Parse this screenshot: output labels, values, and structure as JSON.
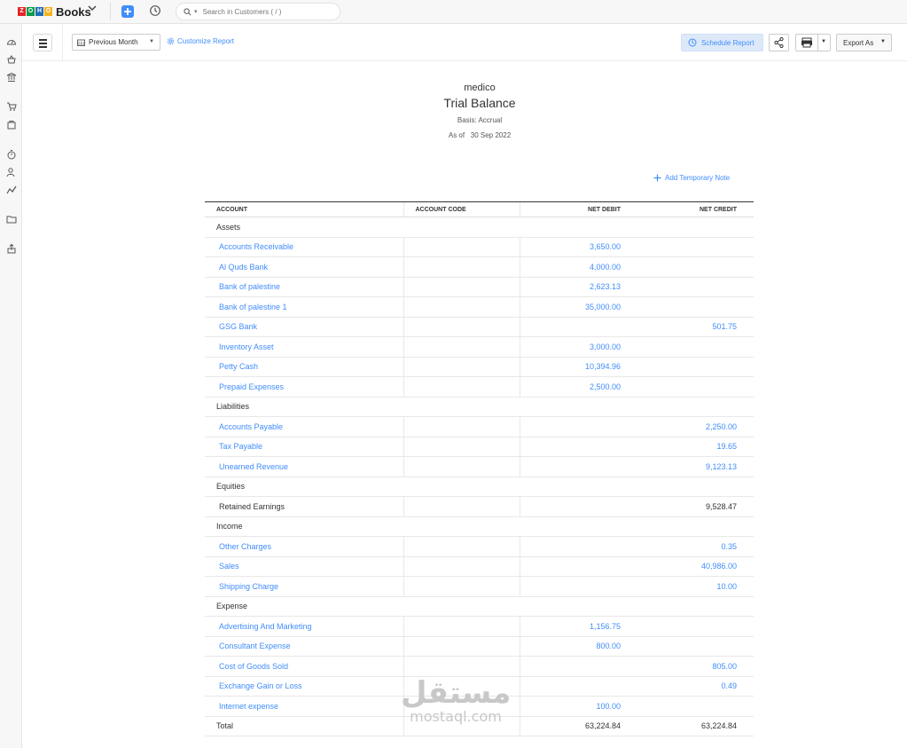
{
  "topbar": {
    "logo_letters": [
      "Z",
      "O",
      "H",
      "O"
    ],
    "logo_colors": [
      "#e42527",
      "#089949",
      "#226db4",
      "#f9b21d"
    ],
    "app_name": "Books",
    "search_placeholder": "Search in Customers ( / )"
  },
  "toolbar": {
    "period": "Previous Month",
    "customize": "Customize Report",
    "schedule": "Schedule Report",
    "export": "Export As"
  },
  "report": {
    "company": "medico",
    "title": "Trial Balance",
    "basis": "Basis: Accrual",
    "as_of_label": "As of",
    "as_of_date": "30 Sep 2022",
    "add_note": "Add Temporary Note",
    "columns": {
      "account": "ACCOUNT",
      "account_code": "ACCOUNT CODE",
      "net_debit": "NET DEBIT",
      "net_credit": "NET CREDIT"
    },
    "rows": [
      {
        "type": "group",
        "account": "Assets"
      },
      {
        "type": "item",
        "account": "Accounts Receivable",
        "code": "",
        "debit": "3,650.00",
        "credit": "",
        "link": true
      },
      {
        "type": "item",
        "account": "Al Quds Bank",
        "code": "",
        "debit": "4,000.00",
        "credit": "",
        "link": true
      },
      {
        "type": "item",
        "account": "Bank of palestine",
        "code": "",
        "debit": "2,623.13",
        "credit": "",
        "link": true
      },
      {
        "type": "item",
        "account": "Bank of palestine 1",
        "code": "",
        "debit": "35,000.00",
        "credit": "",
        "link": true
      },
      {
        "type": "item",
        "account": "GSG Bank",
        "code": "",
        "debit": "",
        "credit": "501.75",
        "link": true
      },
      {
        "type": "item",
        "account": "Inventory Asset",
        "code": "",
        "debit": "3,000.00",
        "credit": "",
        "link": true
      },
      {
        "type": "item",
        "account": "Petty Cash",
        "code": "",
        "debit": "10,394.96",
        "credit": "",
        "link": true
      },
      {
        "type": "item",
        "account": "Prepaid Expenses",
        "code": "",
        "debit": "2,500.00",
        "credit": "",
        "link": true
      },
      {
        "type": "group",
        "account": "Liabilities"
      },
      {
        "type": "item",
        "account": "Accounts Payable",
        "code": "",
        "debit": "",
        "credit": "2,250.00",
        "link": true
      },
      {
        "type": "item",
        "account": "Tax Payable",
        "code": "",
        "debit": "",
        "credit": "19.65",
        "link": true
      },
      {
        "type": "item",
        "account": "Unearned Revenue",
        "code": "",
        "debit": "",
        "credit": "9,123.13",
        "link": true
      },
      {
        "type": "group",
        "account": "Equities"
      },
      {
        "type": "item",
        "account": "Retained Earnings",
        "code": "",
        "debit": "",
        "credit": "9,528.47",
        "link": false
      },
      {
        "type": "group",
        "account": "Income"
      },
      {
        "type": "item",
        "account": "Other Charges",
        "code": "",
        "debit": "",
        "credit": "0.35",
        "link": true
      },
      {
        "type": "item",
        "account": "Sales",
        "code": "",
        "debit": "",
        "credit": "40,986.00",
        "link": true
      },
      {
        "type": "item",
        "account": "Shipping Charge",
        "code": "",
        "debit": "",
        "credit": "10.00",
        "link": true
      },
      {
        "type": "group",
        "account": "Expense"
      },
      {
        "type": "item",
        "account": "Advertising And Marketing",
        "code": "",
        "debit": "1,156.75",
        "credit": "",
        "link": true
      },
      {
        "type": "item",
        "account": "Consultant Expense",
        "code": "",
        "debit": "800.00",
        "credit": "",
        "link": true
      },
      {
        "type": "item",
        "account": "Cost of Goods Sold",
        "code": "",
        "debit": "",
        "credit": "805.00",
        "link": true
      },
      {
        "type": "item",
        "account": "Exchange Gain or Loss",
        "code": "",
        "debit": "",
        "credit": "0.49",
        "link": true
      },
      {
        "type": "item",
        "account": "Internet expense",
        "code": "",
        "debit": "100.00",
        "credit": "",
        "link": true
      },
      {
        "type": "total",
        "account": "Total",
        "code": "",
        "debit": "63,224.84",
        "credit": "63,224.84"
      }
    ]
  },
  "rail_icons": [
    "dashboard-icon",
    "items-icon",
    "banking-icon",
    "sales-cart-icon",
    "purchases-bag-icon",
    "time-tracking-icon",
    "accountant-icon",
    "reports-icon",
    "documents-icon",
    "upload-icon"
  ],
  "watermark": {
    "arabic": "مستقل",
    "latin": "mostaql.com"
  },
  "colors": {
    "accent": "#408dfb",
    "schedule_bg": "#dde9f9"
  }
}
